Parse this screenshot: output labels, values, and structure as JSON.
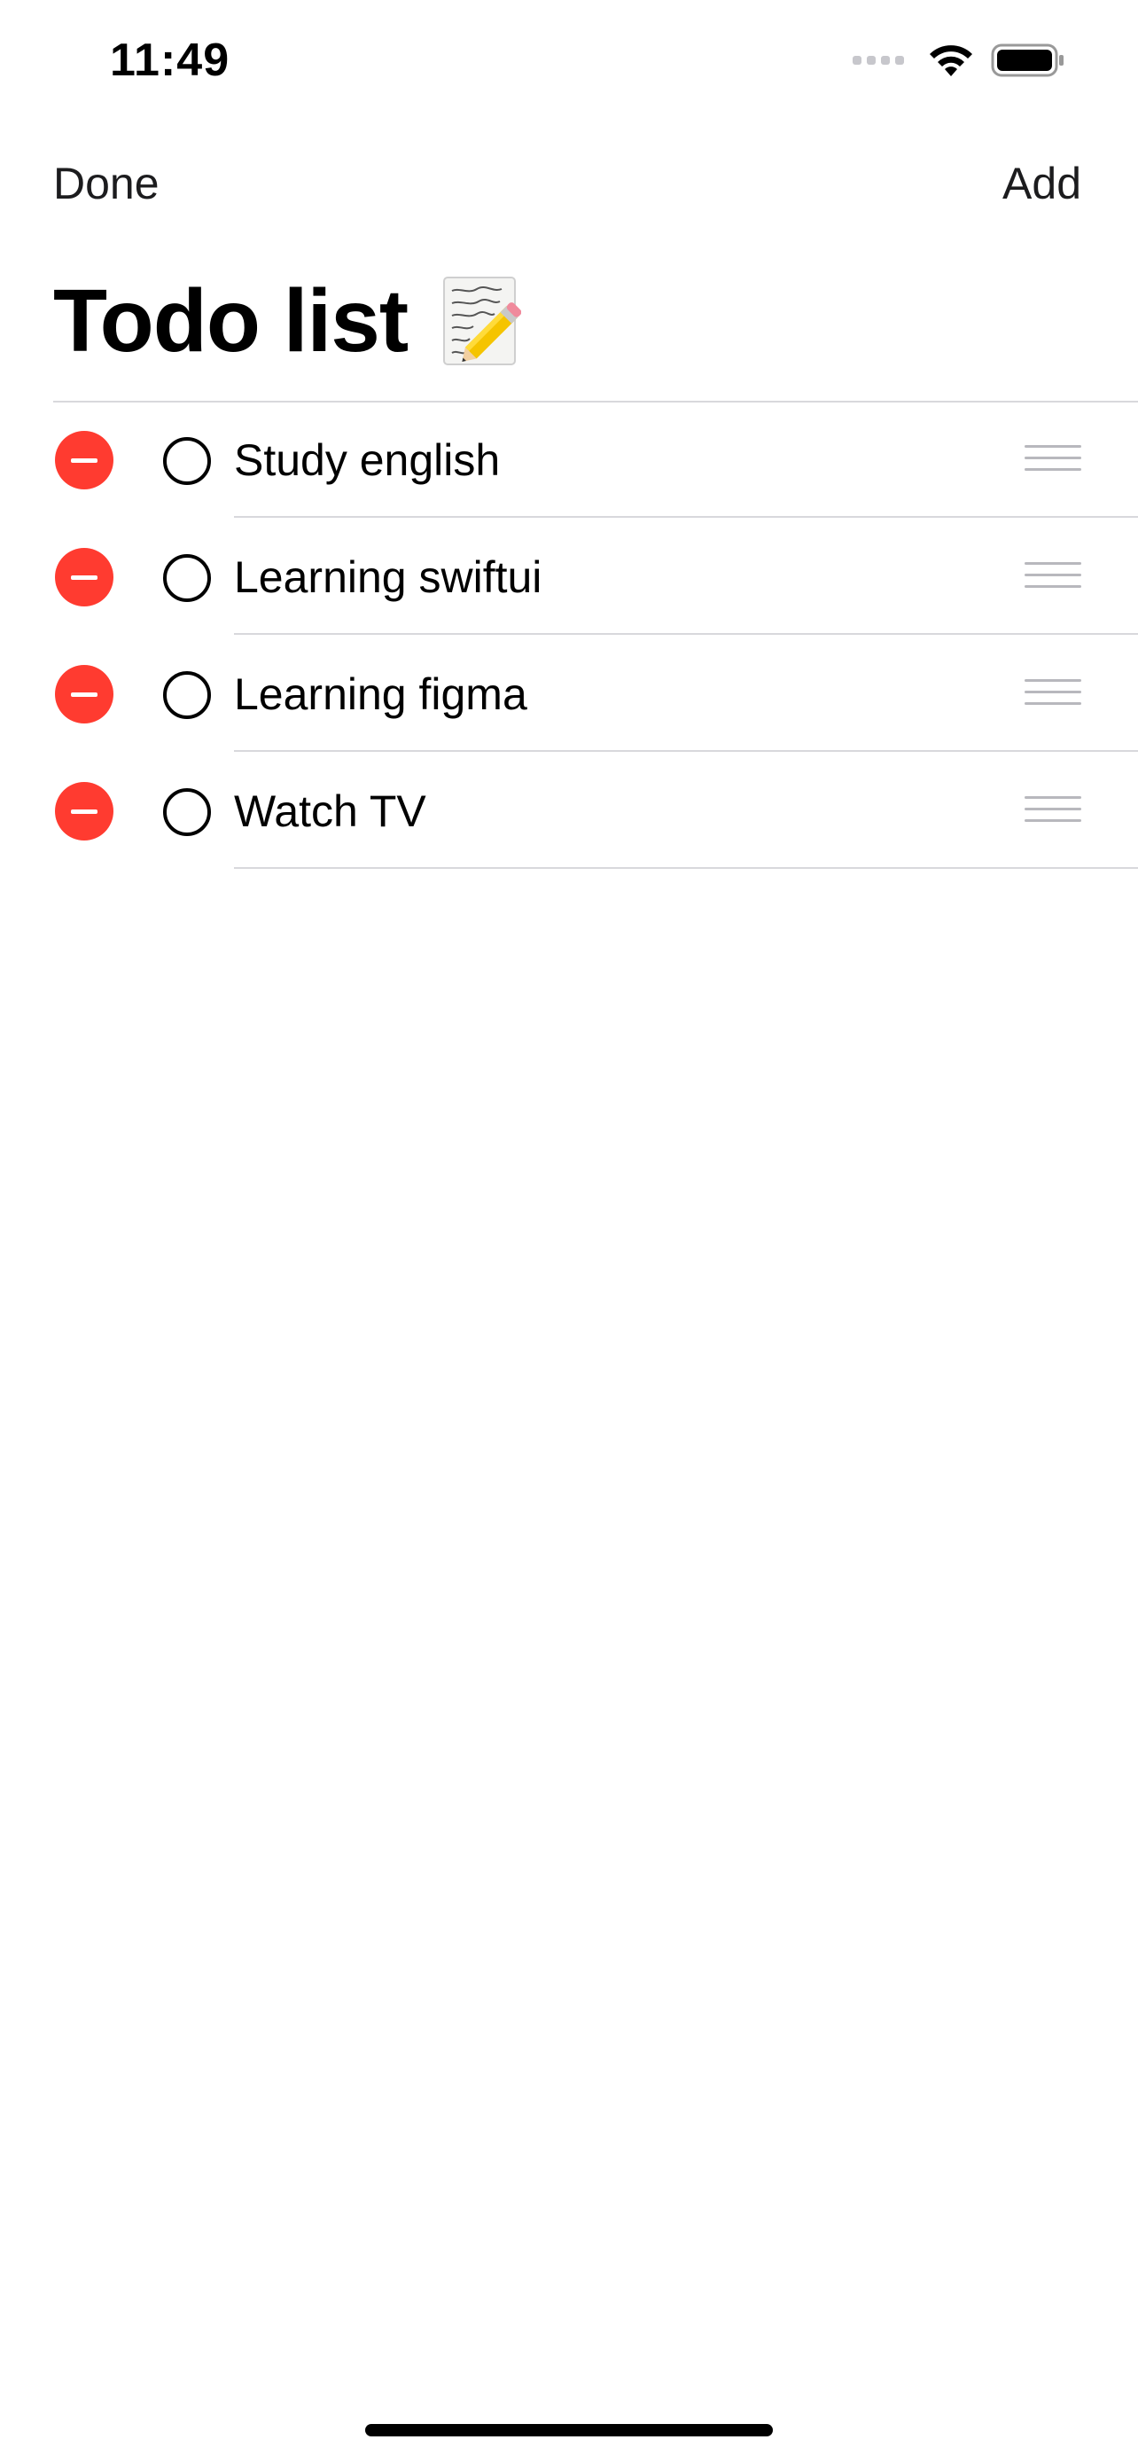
{
  "status_bar": {
    "time": "11:49",
    "icons": [
      "cellular-signal-icon",
      "wifi-icon",
      "battery-icon"
    ]
  },
  "nav": {
    "left_button": "Done",
    "right_button": "Add"
  },
  "title": {
    "text": "Todo list",
    "emoji": "memo-icon"
  },
  "todos": [
    {
      "label": "Study english",
      "completed": false
    },
    {
      "label": "Learning swiftui",
      "completed": false
    },
    {
      "label": "Learning figma",
      "completed": false
    },
    {
      "label": "Watch TV",
      "completed": false
    }
  ],
  "colors": {
    "delete_red": "#ff3b30",
    "text": "#000000",
    "separator": "#d8d8dc",
    "handle": "#b8b8bd"
  }
}
